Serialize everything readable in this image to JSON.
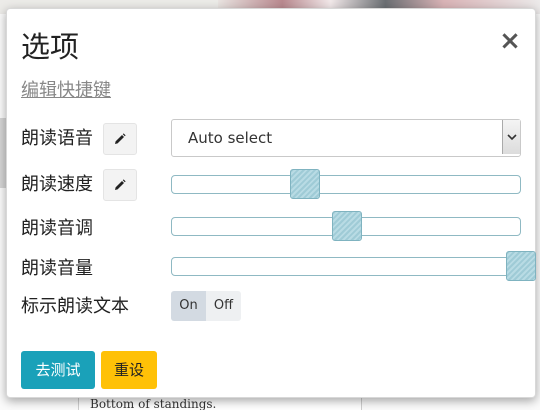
{
  "dialog": {
    "title": "选项",
    "close_glyph": "×",
    "shortcut_link": "编辑快捷键"
  },
  "settings": {
    "voice": {
      "label": "朗读语音",
      "value": "Auto select",
      "edit_icon": "pencil-icon"
    },
    "rate": {
      "label": "朗读速度",
      "value": 0.38,
      "edit_icon": "pencil-icon"
    },
    "pitch": {
      "label": "朗读音调",
      "value": 0.5
    },
    "volume": {
      "label": "朗读音量",
      "value": 1.0
    },
    "highlight": {
      "label": "标示朗读文本",
      "on": "On",
      "off": "Off",
      "selected": "On"
    }
  },
  "actions": {
    "test": "去测试",
    "reset": "重设"
  },
  "background": {
    "snippet": "Bottom of standings."
  },
  "colors": {
    "test_button": "#1aa1b9",
    "reset_button": "#ffc107",
    "slider_thumb": "#9fcbd6"
  }
}
